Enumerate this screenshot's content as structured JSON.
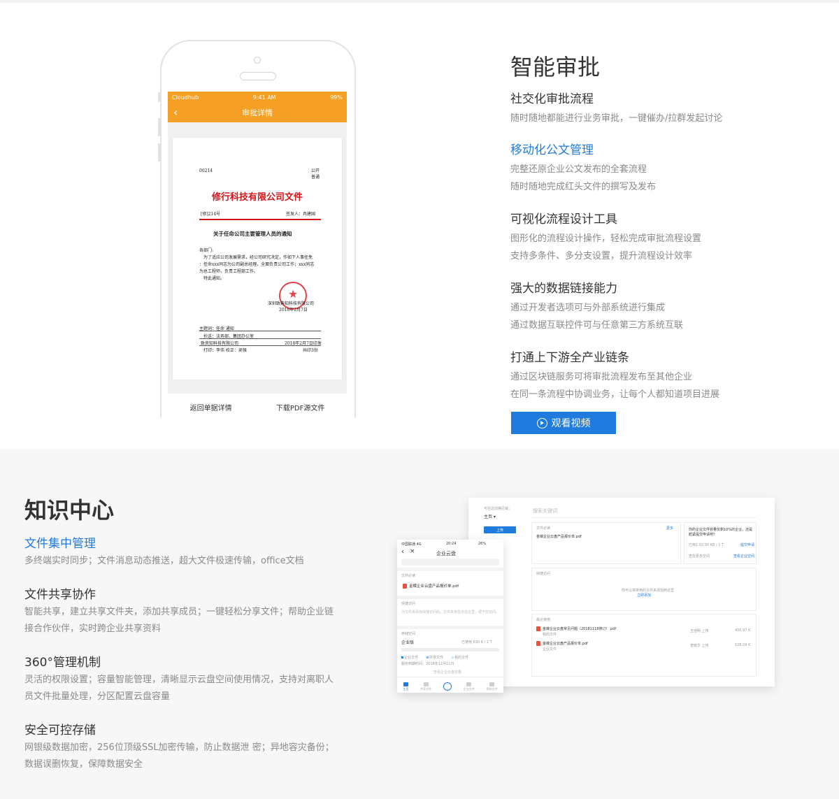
{
  "approval": {
    "title": "智能审批",
    "features": [
      {
        "heading": "社交化审批流程",
        "lines": [
          "随时随地都能进行业务审批，一键催办/拉群发起讨论"
        ]
      },
      {
        "heading": "移动化公文管理",
        "lines": [
          "完整还原企业公文发布的全套流程",
          "随时随地完成红头文件的撰写及发布"
        ]
      },
      {
        "heading": "可视化流程设计工具",
        "lines": [
          "图形化的流程设计操作，轻松完成审批流程设置",
          "支持多条件、多分支设置，提升流程设计效率"
        ]
      },
      {
        "heading": "强大的数据链接能力",
        "lines": [
          "通过开发者选项可与外部系统进行集成",
          "通过数据互联控件可与任意第三方系统互联"
        ]
      },
      {
        "heading": "打通上下游全产业链条",
        "lines": [
          "通过区块链服务可将审批流程发布至其他企业",
          "在同一条流程中协调业务，让每个人都知道项目进展"
        ]
      }
    ],
    "video_button": "观看视频",
    "phone": {
      "carrier": "Cloudhub",
      "time": "9:41 AM",
      "battery": "99%",
      "nav_title": "审批详情",
      "doc": {
        "number": "00214",
        "public": "公开",
        "normal": "普通",
        "company_title": "修行科技有限公司文件",
        "ref": "[修]214号",
        "signer": "签发人：冉建国",
        "subject": "关于任命公司主要管理人员的通知",
        "greeting": "各部门:",
        "body": [
          "为了适应公司发展需求，经公司研究决定，作如下人事任免",
          "：任命xxx同志为公司副总经理，全面负责公司工作；xxx同志",
          "为总工程师，负责工程部工作。",
          "特此通知。"
        ],
        "sign_company": "深圳致典知科技有限公司",
        "sign_date": "2018年2月7日",
        "topic": "主题词：任命 通知",
        "cc": "抄送：法务部、集团办公室",
        "issuer": "致良知科技有限公司",
        "issue_date": "2018年2月7日印发",
        "print": "打印：李伟 校正：吴强",
        "copies": "共印3份"
      },
      "bottom_left": "返回单据详情",
      "bottom_right": "下载PDF源文件"
    }
  },
  "knowledge": {
    "title": "知识中心",
    "features": [
      {
        "heading": "文件集中管理",
        "text": "多终端实时同步；文件消息动态推送，超大文件极速传输，office文档"
      },
      {
        "heading": "文件共享协作",
        "text": "智能共享，建立共享文件夹，添加共享成员；一键轻松分享文件；帮助企业链接合作伙伴，实时跨企业共享资料"
      },
      {
        "heading": "360°管理机制",
        "text": "灵活的权限设置；容量智能管理，清晰显示云盘空间使用情况，支持对离职人员文件批量处理，分区配置云盘容量"
      },
      {
        "heading": "安全可控存储",
        "text": "网银级数据加密，256位顶级SSL加密传输，防止数据泄 密；异地容灾备份；数据误删恢复，保障数据安全"
      }
    ],
    "desktop": {
      "switch_label": "可在这切换区域：",
      "area": "主页 ▾",
      "search_placeholder": "搜索关键词",
      "upload": "上传",
      "must_see": "文件必读",
      "more": "更多",
      "must_file": "金蝶企业云盘产品报价单.pdf",
      "notice": "你的企业文件容量仅剩10%的企业，还是赶紧提交申请吧？",
      "notice_date": "已用1.02.00 KB / 1 T",
      "apply": "提交申请",
      "space_label": "查找更多空间",
      "space_link": "查看企业空间",
      "quick": "快捷访问",
      "quick_empty": "你可以将常用的文件夹添加到这里",
      "quick_link": "立即添加",
      "recent": "最近使用",
      "recent_files": [
        {
          "name": "金蝶企业云盘常见问题（20181118修订）.pdf",
          "sub": "我的文件",
          "owner": "王佳明 上传",
          "size": "400.97 K"
        },
        {
          "name": "金蝶企业云盘产品报价单.pdf",
          "sub": "企业文件",
          "owner": "李晓华 上传",
          "size": "128.09 K"
        }
      ]
    },
    "mobile": {
      "carrier": "中国联通 4G",
      "time": "20:24",
      "battery": "26%",
      "title": "企业云盘",
      "must_see": "文件必读",
      "must_file": "金蝶企业云盘产品报价单.pdf",
      "quick": "快捷访问",
      "quick_empty": "为文件夹添加快捷访问后，文件夹将显示在这里，便于您访问。",
      "storage": "存储空间",
      "edition": "企业版",
      "used": "已使用 630 K / 1 T",
      "legend": [
        "企业文件",
        "共享文件",
        "我的文件"
      ],
      "expire": "服务到期时间：2018年12月11日",
      "view_space": "查看企业云盘容量",
      "recent": "最近使用",
      "tabs": [
        "主页",
        "共享文件",
        "",
        "企业文件",
        "我的文件"
      ]
    }
  },
  "colors": {
    "accent": "#1f7bde",
    "orange": "#f59f25",
    "red": "#d8141a"
  }
}
